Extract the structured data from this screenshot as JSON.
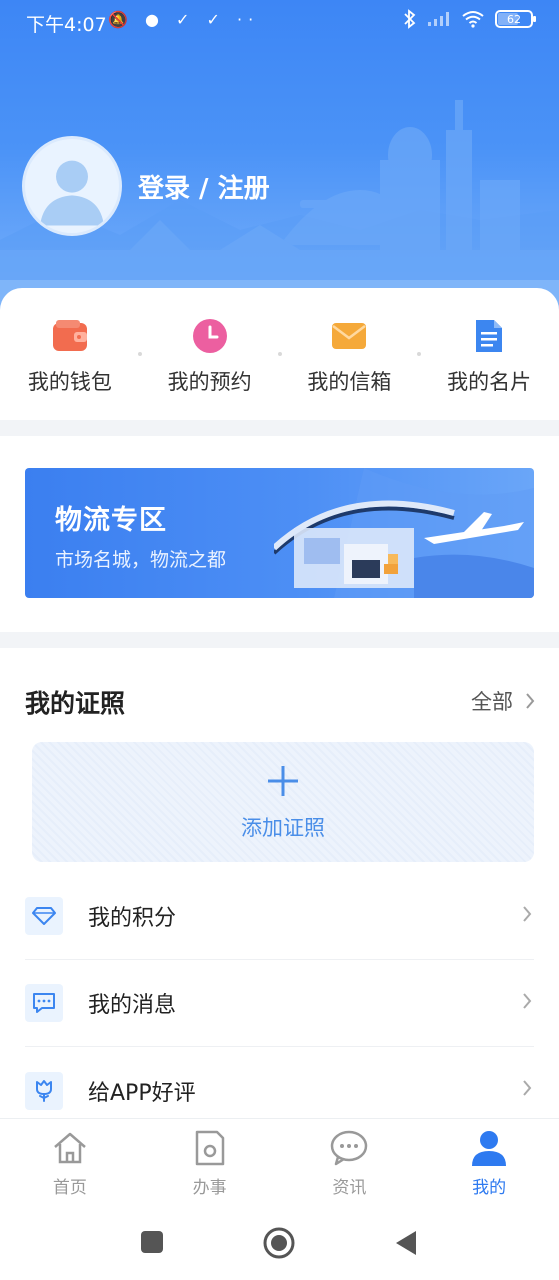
{
  "status_bar": {
    "time": "下午4:07",
    "left_icons": "🔕 ● ✓ ✓ ··",
    "battery": "62",
    "battery_level": 0.62
  },
  "profile": {
    "login_label": "登录 / 注册"
  },
  "quick_actions": [
    {
      "label": "我的钱包",
      "icon": "wallet-icon",
      "color": "#f26c4f"
    },
    {
      "label": "我的预约",
      "icon": "clock-icon",
      "color": "#ec5fa0"
    },
    {
      "label": "我的信箱",
      "icon": "mail-icon",
      "color": "#f5a93a"
    },
    {
      "label": "我的名片",
      "icon": "document-icon",
      "color": "#3c86f0"
    }
  ],
  "banner": {
    "title": "物流专区",
    "subtitle": "市场名城，物流之都"
  },
  "licenses": {
    "title": "我的证照",
    "all_label": "全部",
    "add_label": "添加证照"
  },
  "menu": [
    {
      "label": "我的积分",
      "icon": "diamond-icon"
    },
    {
      "label": "我的消息",
      "icon": "message-icon"
    },
    {
      "label": "给APP好评",
      "icon": "flower-icon"
    }
  ],
  "tabs": [
    {
      "label": "首页",
      "icon": "home-icon",
      "active": false
    },
    {
      "label": "办事",
      "icon": "tasks-icon",
      "active": false
    },
    {
      "label": "资讯",
      "icon": "chat-icon",
      "active": false
    },
    {
      "label": "我的",
      "icon": "user-icon",
      "active": true
    }
  ],
  "colors": {
    "brand": "#3d86f5",
    "tab_active": "#2e7af0",
    "menu_icon": "#3c86f0"
  }
}
